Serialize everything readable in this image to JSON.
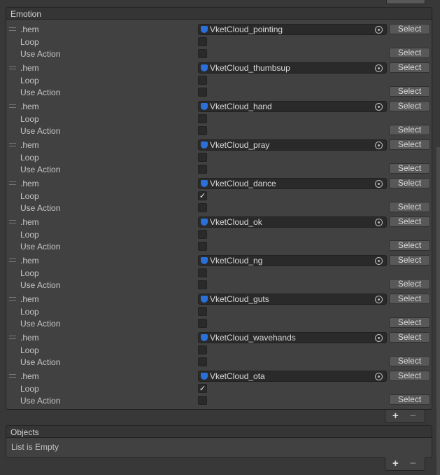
{
  "emotion": {
    "title": "Emotion",
    "items": [
      {
        "label": ".hem",
        "asset": "VketCloud_pointing",
        "loop": false
      },
      {
        "label": ".hem",
        "asset": "VketCloud_thumbsup",
        "loop": false
      },
      {
        "label": ".hem",
        "asset": "VketCloud_hand",
        "loop": false
      },
      {
        "label": ".hem",
        "asset": "VketCloud_pray",
        "loop": false
      },
      {
        "label": ".hem",
        "asset": "VketCloud_dance",
        "loop": true
      },
      {
        "label": ".hem",
        "asset": "VketCloud_ok",
        "loop": false
      },
      {
        "label": ".hem",
        "asset": "VketCloud_ng",
        "loop": false
      },
      {
        "label": ".hem",
        "asset": "VketCloud_guts",
        "loop": false
      },
      {
        "label": ".hem",
        "asset": "VketCloud_wavehands",
        "loop": false
      },
      {
        "label": ".hem",
        "asset": "VketCloud_ota",
        "loop": true
      }
    ],
    "loop_label": "Loop",
    "use_action_label": "Use Action",
    "select_label": "Select",
    "use_action": false
  },
  "objects": {
    "title": "Objects",
    "empty_text": "List is Empty"
  },
  "footer": {
    "add": "+",
    "remove": "−"
  },
  "icons": {
    "asset": "unity-asset-icon",
    "picker": "object-picker-icon",
    "handle": "drag-handle-icon"
  }
}
